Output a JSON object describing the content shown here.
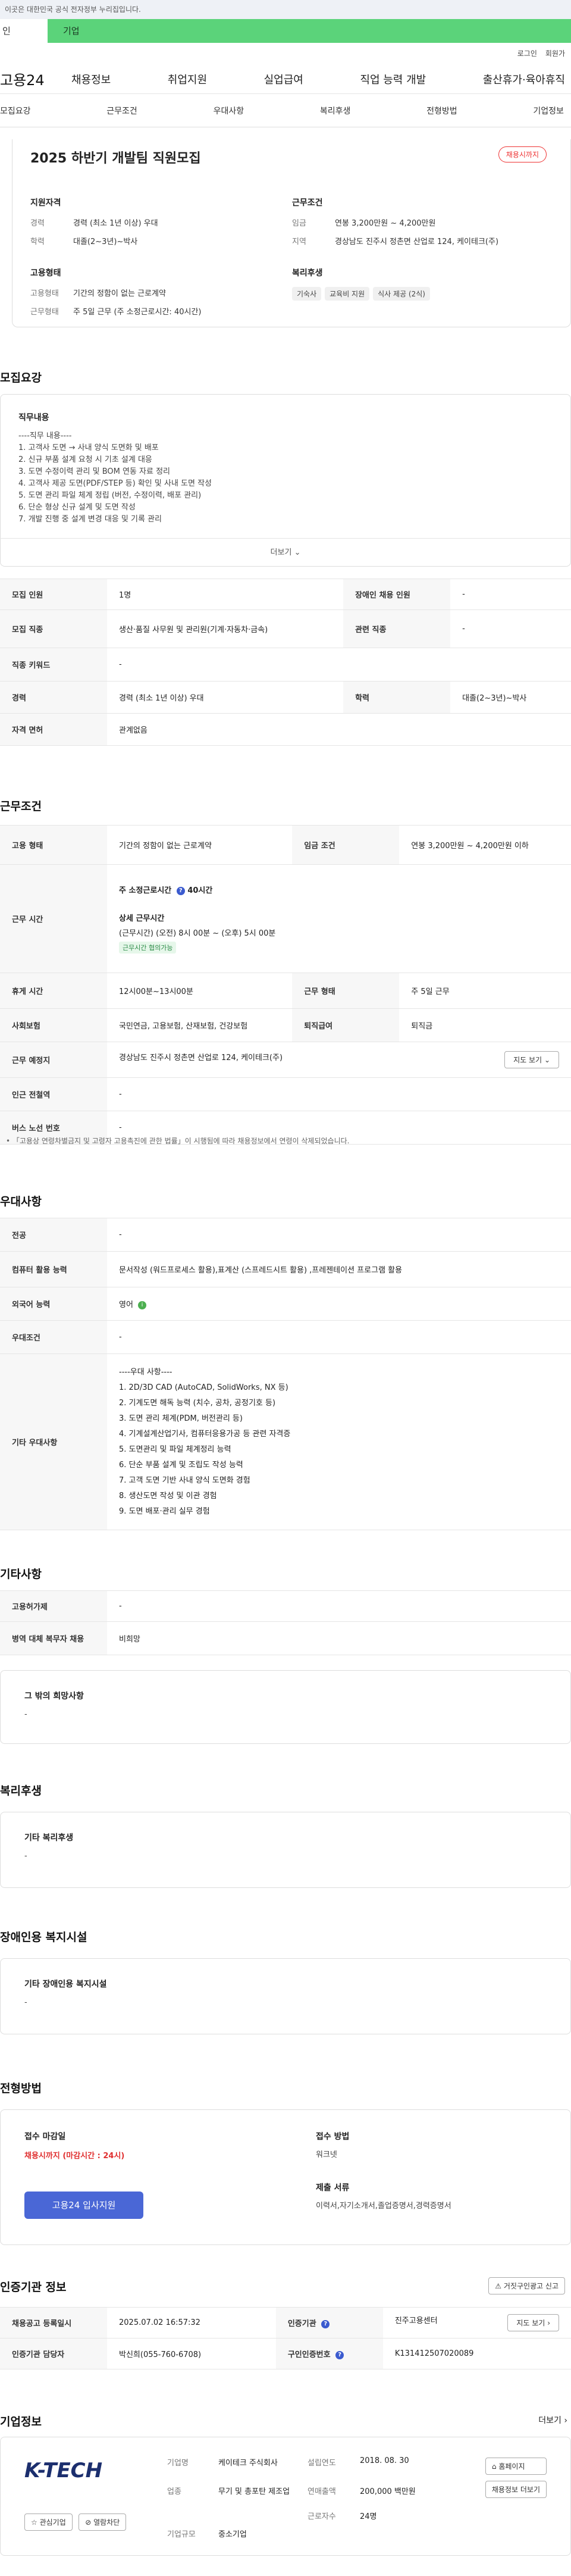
{
  "topbar": {
    "notice": "이곳은 대한민국 공식 전자정부 누리집입니다."
  },
  "usertabs": {
    "person": "인",
    "company": "기업"
  },
  "util": {
    "login": "로그인",
    "member": "회원가"
  },
  "gnb": {
    "logo": "고용24",
    "menu": [
      "채용정보",
      "취업지원",
      "실업급여",
      "직업 능력 개발",
      "출산휴가·육아휴직"
    ]
  },
  "lnb": {
    "items": [
      "모집요강",
      "근무조건",
      "우대사항",
      "복리후생",
      "전형방법",
      "기업정보"
    ]
  },
  "summary": {
    "title": "2025 하반기 개발팀 직원모집",
    "status": "채용시까지",
    "qual": {
      "heading": "지원자격",
      "career_k": "경력",
      "career_v": "경력 (최소 1년 이상) 우대",
      "edu_k": "학력",
      "edu_v": "대졸(2~3년)~박사"
    },
    "cond": {
      "heading": "근무조건",
      "wage_k": "임금",
      "wage_v": "연봉 3,200만원 ~ 4,200만원",
      "area_k": "지역",
      "area_v": "경상남도 진주시 정촌면 산업로 124, 케이테크(주)"
    },
    "emp": {
      "heading": "고용형태",
      "type_k": "고용형태",
      "type_v": "기간의 정함이 없는 근로계약",
      "hours_k": "근무형태",
      "hours_v": "주 5일 근무 (주 소정근로시간: 40시간)"
    },
    "welfare": {
      "heading": "복리후생",
      "chips": [
        "기숙사",
        "교육비 지원",
        "식사 제공 (2식)"
      ]
    }
  },
  "recruit": {
    "title": "모집요강",
    "duty_heading": "직무내용",
    "duty_lines": [
      "----직무 내용----",
      "1. 고객사 도면 → 사내 양식 도면화 및 배포",
      "2. 신규 부품 설계 요청 시 기초 설계 대응",
      "3. 도면 수정이력 관리 및 BOM 연동 자료 정리",
      "4. 고객사 제공 도면(PDF/STEP 등) 확인 및 사내 도면 작성",
      "5. 도면 관리 파일 체계 정립 (버전, 수정이력, 배포 관리)",
      "6. 단순 형상 신규 설계 및 도면 작성",
      "7. 개발 진행 중 설계 변경 대응 및 기록 관리"
    ],
    "more": "더보기",
    "rows": [
      {
        "k1": "모집 인원",
        "v1": "1명",
        "k2": "장애인 채용 인원",
        "v2": "-"
      },
      {
        "k1": "모집 직종",
        "v1": "생산·품질 사무원 및 관리원(기계·자동차·금속)",
        "k2": "관련 직종",
        "v2": "-"
      },
      {
        "k1": "직종 키워드",
        "v1": "-",
        "k2": "",
        "v2": ""
      },
      {
        "k1": "경력",
        "v1": "경력 (최소 1년 이상) 우대",
        "k2": "학력",
        "v2": "대졸(2~3년)~박사"
      },
      {
        "k1": "자격 면허",
        "v1": "관계없음",
        "k2": "",
        "v2": ""
      }
    ]
  },
  "work": {
    "title": "근무조건",
    "emp_k": "고용 형태",
    "emp_v": "기간의 정함이 없는 근로계약",
    "wage_k": "임금 조건",
    "wage_v": "연봉 3,200만원 ~ 4,200만원 이하",
    "time_k": "근무 시간",
    "weekly": "주 소정근로시간",
    "weekly_v": "40시간",
    "detail_heading": "상세 근무시간",
    "detail_v": "(근무시간) (오전) 8시 00분 ~ (오후) 5시 00분",
    "detail_chip": "근무시간 협의가능",
    "break_k": "휴게 시간",
    "break_v": "12시00분~13시00분",
    "shift_k": "근무 형태",
    "shift_v": "주 5일 근무",
    "ins_k": "사회보험",
    "ins_v": "국민연금, 고용보험, 산재보험, 건강보험",
    "ret_k": "퇴직급여",
    "ret_v": "퇴직금",
    "place_k": "근무 예정지",
    "place_v": "경상남도 진주시 정촌면 산업로 124, 케이테크(주)",
    "map_btn": "지도 보기",
    "sub_k": "인근 전철역",
    "sub_v": "-",
    "bus_k": "버스 노선 번호",
    "bus_v": "-",
    "note": "「고용상 연령차별금지 및 고령자 고용촉진에 관한 법률」이 시행됨에 따라 채용정보에서 연령이 삭제되었습니다."
  },
  "pref": {
    "title": "우대사항",
    "rows": [
      {
        "k": "전공",
        "v": "-"
      },
      {
        "k": "컴퓨터 활용 능력",
        "v": "문서작성 (워드프로세스 활용),표계산 (스프레드시트 활용) ,프레젠테이션 프로그램 활용"
      },
      {
        "k": "외국어 능력",
        "v": "영어"
      },
      {
        "k": "우대조건",
        "v": "-"
      }
    ],
    "etc_k": "기타 우대사항",
    "etc_lines": [
      "----우대 사항----",
      "1. 2D/3D CAD (AutoCAD, SolidWorks, NX 등)",
      "2. 기계도면 해독 능력 (치수, 공차, 공정기호 등)",
      "3. 도면 관리 체계(PDM, 버전관리 등)",
      "4. 기계설계산업기사, 컴퓨터응용가공 등 관련 자격증",
      "5. 도면관리 및 파일 체계정리 능력",
      "6. 단순 부품 설계 및 조립도 작성 능력",
      "7. 고객 도면 기반 사내 양식 도면화 경험",
      "8. 생산도면 작성 및 이관 경험",
      "9. 도면 배포·관리 실무 경험"
    ]
  },
  "etc": {
    "title": "기타사항",
    "rows": [
      {
        "k": "고용허가제",
        "v": "-"
      },
      {
        "k": "병역 대체 복무자 채용",
        "v": "비희망"
      }
    ],
    "hope_heading": "그 밖의 희망사항",
    "hope_v": "-"
  },
  "welfare": {
    "title": "복리후생",
    "heading": "기타 복리후생",
    "v": "-"
  },
  "disabled": {
    "title": "장애인용 복지시설",
    "heading": "기타 장애인용 복지시설",
    "v": "-"
  },
  "screening": {
    "title": "전형방법",
    "deadline_heading": "접수 마감일",
    "deadline_v": "채용시까지 (마감시간 : 24시)",
    "apply_btn": "고용24 입사지원",
    "method_heading": "접수 방법",
    "method_v": "워크넷",
    "docs_heading": "제출 서류",
    "docs_v": "이력서,자기소개서,졸업증명서,경력증명서"
  },
  "agency": {
    "title": "인증기관 정보",
    "copy_btn": "거짓구인광고 신고",
    "reg_k": "채용공고 등록일시",
    "reg_v": "2025.07.02 16:57:32",
    "org_k": "인증기관",
    "org_v": "진주고용센터",
    "map_btn": "지도 보기",
    "mgr_k": "인증기관 담당자",
    "mgr_v": "박신희(055-760-6708)",
    "no_k": "구인인증번호",
    "no_v": "K131412507020089"
  },
  "company": {
    "title": "기업정보",
    "more": "더보기",
    "logo_text": "K-TECH",
    "interest_btn": "관심기업",
    "block_btn": "열람차단",
    "name_k": "기업명",
    "name_v": "케이테크 주식회사",
    "year_k": "설립연도",
    "year_v": "2018. 08. 30",
    "ind_k": "업종",
    "ind_v": "무기 및 총포탄 제조업",
    "sales_k": "연매출액",
    "sales_v": "200,000 백만원",
    "emp_k": "근로자수",
    "emp_v": "24명",
    "size_k": "기업규모",
    "size_v": "중소기업",
    "home_btn": "홈페이지",
    "list_btn": "채용정보 더보기"
  }
}
